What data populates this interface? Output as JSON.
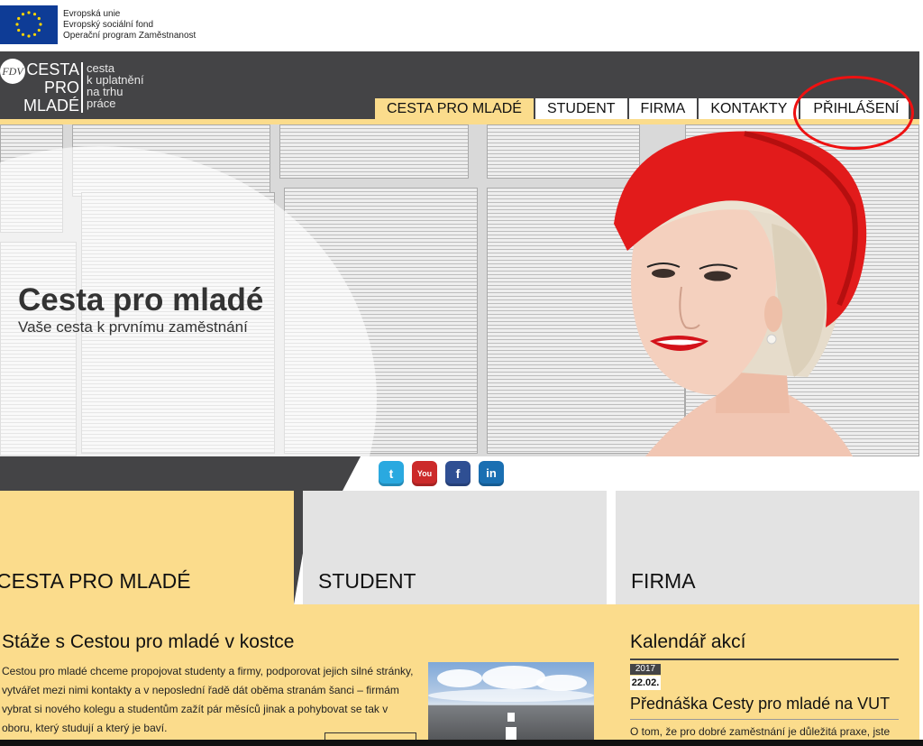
{
  "eu": {
    "line1": "Evropská unie",
    "line2": "Evropský sociální fond",
    "line3": "Operační program Zaměstnanost",
    "flag_color": "#0e3c96"
  },
  "logo": {
    "badge": "FDV",
    "main": [
      "CESTA",
      "PRO",
      "MLADÉ"
    ],
    "sub": [
      "cesta",
      "k uplatnění",
      "na trhu",
      "práce"
    ]
  },
  "nav": {
    "items": [
      {
        "label": "CESTA PRO MLADÉ",
        "active": true
      },
      {
        "label": "STUDENT",
        "active": false
      },
      {
        "label": "FIRMA",
        "active": false
      },
      {
        "label": "KONTAKTY",
        "active": false
      },
      {
        "label": "PŘIHLÁŠENÍ",
        "active": false
      }
    ]
  },
  "hero": {
    "title": "Cesta pro mladé",
    "subtitle": "Vaše cesta k prvnímu zaměstnání"
  },
  "social": [
    {
      "name": "twitter-icon",
      "glyph": "t"
    },
    {
      "name": "youtube-icon",
      "glyph": "You Tube"
    },
    {
      "name": "facebook-icon",
      "glyph": "f"
    },
    {
      "name": "linkedin-icon",
      "glyph": "in"
    }
  ],
  "tiles": {
    "cesta": "CESTA PRO MLADÉ",
    "student": "STUDENT",
    "firma": "FIRMA"
  },
  "article": {
    "title": "Stáže s Cestou pro mladé v kostce",
    "text": "Cestou pro mladé chceme propojovat studenty a firmy, podporovat jejich silné stránky, vytvářet mezi nimi kontakty a v neposlední řadě dát oběma stranám šanci – firmám vybrat si nového kolegu a studentům zažít pár měsíců jinak a pohybovat se tak v oboru, který studují a který je baví."
  },
  "calendar": {
    "title": "Kalendář akcí",
    "year": "2017",
    "day": "22.02.",
    "event_title": "Přednáška Cesty pro mladé na VUT",
    "event_text": "O tom, že pro dobré zaměstnání je důležitá praxe, jste"
  },
  "colors": {
    "accent_yellow": "#fbdc8c",
    "dark_gray": "#444446",
    "highlight_red": "#e11111"
  }
}
